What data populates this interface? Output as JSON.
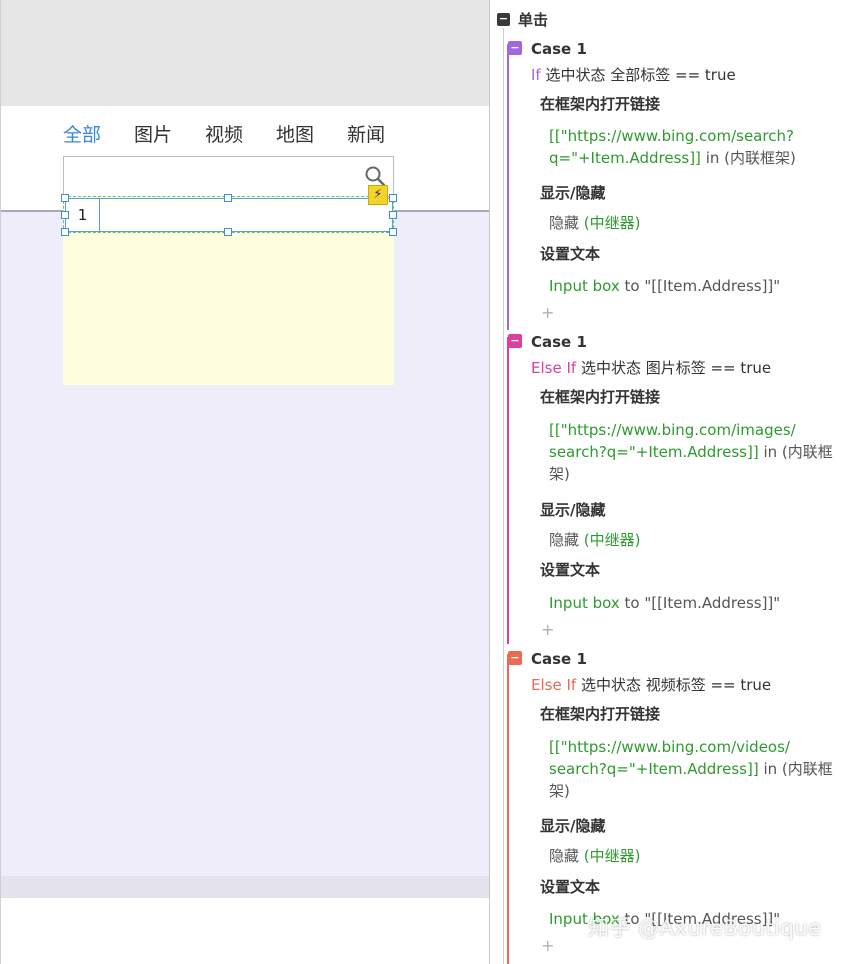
{
  "canvas": {
    "tabs": [
      {
        "label": "全部",
        "active": true
      },
      {
        "label": "图片",
        "active": false
      },
      {
        "label": "视频",
        "active": false
      },
      {
        "label": "地图",
        "active": false
      },
      {
        "label": "新闻",
        "active": false
      }
    ],
    "search_placeholder": "",
    "repeater_first_cell": "1",
    "interaction_marker": "⚡",
    "colors": {
      "active_tab": "#3a86d8",
      "repeater_bg": "#ffffe0",
      "lavender_area": "#f0edfa"
    }
  },
  "panel": {
    "event_icon": "−",
    "event_title": "单击",
    "cases": [
      {
        "icon": "−",
        "color": "#a068e0",
        "title": "Case 1",
        "cond_keyword": "If",
        "cond_text": " 选中状态 全部标签 == true",
        "action1_title": "在框架内打开链接",
        "action1_link_line1": "[[\"https://www.bing.com/search?",
        "action1_link_line2": "q=\"+Item.Address]]",
        "action1_tail": " in (内联框架)",
        "action2_title": "显示/隐藏",
        "action2_verb": "隐藏 ",
        "action2_target": "(中继器)",
        "action3_title": "设置文本",
        "action3_target": "Input box",
        "action3_rest": " to \"[[Item.Address]]\"",
        "add": "+"
      },
      {
        "icon": "−",
        "color": "#dc3f9e",
        "title": "Case 1",
        "cond_keyword": "Else If",
        "cond_text": " 选中状态 图片标签 == true",
        "action1_title": "在框架内打开链接",
        "action1_link_line1": "[[\"https://www.bing.com/images/",
        "action1_link_line2": "search?q=\"+Item.Address]]",
        "action1_tail": " in (内联框架)",
        "action2_title": "显示/隐藏",
        "action2_verb": "隐藏 ",
        "action2_target": "(中继器)",
        "action3_title": "设置文本",
        "action3_target": "Input box",
        "action3_rest": " to \"[[Item.Address]]\"",
        "add": "+"
      },
      {
        "icon": "−",
        "color": "#ea6a55",
        "title": "Case 1",
        "cond_keyword": "Else If",
        "cond_text": " 选中状态 视频标签 == true",
        "action1_title": "在框架内打开链接",
        "action1_link_line1": "[[\"https://www.bing.com/videos/",
        "action1_link_line2": "search?q=\"+Item.Address]]",
        "action1_tail": " in (内联框架)",
        "action2_title": "显示/隐藏",
        "action2_verb": "隐藏 ",
        "action2_target": "(中继器)",
        "action3_title": "设置文本",
        "action3_target": "Input box",
        "action3_rest": " to \"[[Item.Address]]\"",
        "add": "+"
      }
    ]
  },
  "watermark": "知乎 @AxureBoutique"
}
